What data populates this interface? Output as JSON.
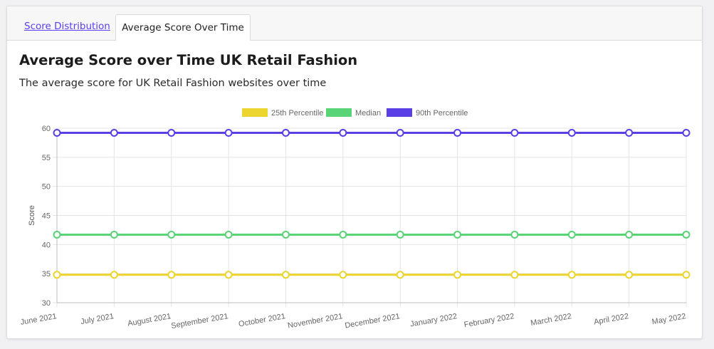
{
  "tabs": [
    {
      "label": "Score Distribution",
      "active": false
    },
    {
      "label": "Average Score Over Time",
      "active": true
    }
  ],
  "heading": "Average Score over Time UK Retail Fashion",
  "description": "The average score for UK Retail Fashion websites over time",
  "chart_data": {
    "type": "line",
    "x": [
      "June 2021",
      "July 2021",
      "August 2021",
      "September 2021",
      "October 2021",
      "November 2021",
      "December 2021",
      "January 2022",
      "February 2022",
      "March 2022",
      "April 2022",
      "May 2022"
    ],
    "series": [
      {
        "name": "25th Percentile",
        "color": "#ecd52f",
        "values": [
          34.8,
          34.8,
          34.8,
          34.8,
          34.8,
          34.8,
          34.8,
          34.8,
          34.8,
          34.8,
          34.8,
          34.8
        ]
      },
      {
        "name": "Median",
        "color": "#58d476",
        "values": [
          41.7,
          41.7,
          41.7,
          41.7,
          41.7,
          41.7,
          41.7,
          41.7,
          41.7,
          41.7,
          41.7,
          41.7
        ]
      },
      {
        "name": "90th Percentile",
        "color": "#5a3ee6",
        "values": [
          59.2,
          59.2,
          59.2,
          59.2,
          59.2,
          59.2,
          59.2,
          59.2,
          59.2,
          59.2,
          59.2,
          59.2
        ]
      }
    ],
    "ylabel": "Score",
    "xlabel": "",
    "ylim": [
      30,
      60
    ],
    "yticks": [
      30,
      35,
      40,
      45,
      50,
      55,
      60
    ],
    "grid": true,
    "legend": "top-center"
  }
}
